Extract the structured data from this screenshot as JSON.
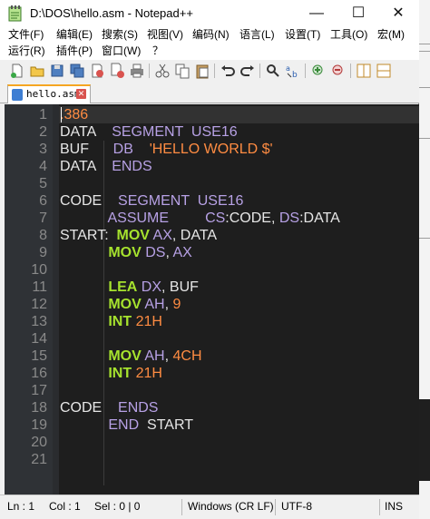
{
  "window": {
    "title": "D:\\DOS\\hello.asm - Notepad++",
    "minimize_glyph": "—",
    "maximize_glyph": "☐",
    "close_glyph": "✕"
  },
  "menu": {
    "row1": [
      "文件(F)",
      "编辑(E)",
      "搜索(S)",
      "视图(V)",
      "编码(N)",
      "语言(L)",
      "设置(T)",
      "工具(O)",
      "宏(M)"
    ],
    "row2": [
      "运行(R)",
      "插件(P)",
      "窗口(W)",
      "？"
    ]
  },
  "toolbar": {
    "icons": [
      "new-file-icon",
      "open-file-icon",
      "save-icon",
      "save-all-icon",
      "close-file-icon",
      "close-all-icon",
      "print-icon",
      "cut-icon",
      "copy-icon",
      "paste-icon",
      "undo-icon",
      "redo-icon",
      "find-icon",
      "replace-icon",
      "zoom-in-icon",
      "zoom-out-icon",
      "sync-scroll-vertical-icon",
      "sync-scroll-horizontal-icon"
    ]
  },
  "tab": {
    "label": "hello.asm",
    "close_glyph": "✕"
  },
  "editor": {
    "line_numbers": [
      "1",
      "2",
      "3",
      "4",
      "5",
      "6",
      "7",
      "8",
      "9",
      "10",
      "11",
      "12",
      "13",
      "14",
      "15",
      "16",
      "17",
      "18",
      "19",
      "20",
      "21"
    ],
    "lines": [
      {
        "n": 1,
        "tokens": [
          {
            "t": ".386",
            "c": "num"
          }
        ]
      },
      {
        "n": 2,
        "tokens": [
          {
            "t": "DATA    ",
            "c": "plain"
          },
          {
            "t": "SEGMENT",
            "c": "kw-seg"
          },
          {
            "t": "  ",
            "c": "plain"
          },
          {
            "t": "USE16",
            "c": "kw-seg"
          }
        ]
      },
      {
        "n": 3,
        "tokens": [
          {
            "t": "BUF      ",
            "c": "plain"
          },
          {
            "t": "DB",
            "c": "kw-seg"
          },
          {
            "t": "    ",
            "c": "plain"
          },
          {
            "t": "'HELLO WORLD $'",
            "c": "str"
          }
        ]
      },
      {
        "n": 4,
        "tokens": [
          {
            "t": "DATA    ",
            "c": "plain"
          },
          {
            "t": "ENDS",
            "c": "kw-seg"
          }
        ]
      },
      {
        "n": 5,
        "tokens": []
      },
      {
        "n": 6,
        "tokens": [
          {
            "t": "CODE    ",
            "c": "plain"
          },
          {
            "t": "SEGMENT",
            "c": "kw-seg"
          },
          {
            "t": "  ",
            "c": "plain"
          },
          {
            "t": "USE16",
            "c": "kw-seg"
          }
        ]
      },
      {
        "n": 7,
        "tokens": [
          {
            "t": "            ",
            "c": "plain"
          },
          {
            "t": "ASSUME",
            "c": "kw-seg"
          },
          {
            "t": "         ",
            "c": "plain"
          },
          {
            "t": "CS",
            "c": "kw-reg"
          },
          {
            "t": ":CODE, ",
            "c": "plain"
          },
          {
            "t": "DS",
            "c": "kw-reg"
          },
          {
            "t": ":DATA",
            "c": "plain"
          }
        ]
      },
      {
        "n": 8,
        "tokens": [
          {
            "t": "START:  ",
            "c": "plain"
          },
          {
            "t": "MOV",
            "c": "kw-ins"
          },
          {
            "t": " ",
            "c": "plain"
          },
          {
            "t": "AX",
            "c": "kw-reg"
          },
          {
            "t": ", DATA",
            "c": "plain"
          }
        ]
      },
      {
        "n": 9,
        "tokens": [
          {
            "t": "            ",
            "c": "plain"
          },
          {
            "t": "MOV",
            "c": "kw-ins"
          },
          {
            "t": " ",
            "c": "plain"
          },
          {
            "t": "DS",
            "c": "kw-reg"
          },
          {
            "t": ", ",
            "c": "plain"
          },
          {
            "t": "AX",
            "c": "kw-reg"
          }
        ]
      },
      {
        "n": 10,
        "tokens": []
      },
      {
        "n": 11,
        "tokens": [
          {
            "t": "            ",
            "c": "plain"
          },
          {
            "t": "LEA",
            "c": "kw-ins"
          },
          {
            "t": " ",
            "c": "plain"
          },
          {
            "t": "DX",
            "c": "kw-reg"
          },
          {
            "t": ", BUF",
            "c": "plain"
          }
        ]
      },
      {
        "n": 12,
        "tokens": [
          {
            "t": "            ",
            "c": "plain"
          },
          {
            "t": "MOV",
            "c": "kw-ins"
          },
          {
            "t": " ",
            "c": "plain"
          },
          {
            "t": "AH",
            "c": "kw-reg"
          },
          {
            "t": ", ",
            "c": "plain"
          },
          {
            "t": "9",
            "c": "num"
          }
        ]
      },
      {
        "n": 13,
        "tokens": [
          {
            "t": "            ",
            "c": "plain"
          },
          {
            "t": "INT",
            "c": "kw-ins"
          },
          {
            "t": " ",
            "c": "plain"
          },
          {
            "t": "21H",
            "c": "num"
          }
        ]
      },
      {
        "n": 14,
        "tokens": []
      },
      {
        "n": 15,
        "tokens": [
          {
            "t": "            ",
            "c": "plain"
          },
          {
            "t": "MOV",
            "c": "kw-ins"
          },
          {
            "t": " ",
            "c": "plain"
          },
          {
            "t": "AH",
            "c": "kw-reg"
          },
          {
            "t": ", ",
            "c": "plain"
          },
          {
            "t": "4CH",
            "c": "num"
          }
        ]
      },
      {
        "n": 16,
        "tokens": [
          {
            "t": "            ",
            "c": "plain"
          },
          {
            "t": "INT",
            "c": "kw-ins"
          },
          {
            "t": " ",
            "c": "plain"
          },
          {
            "t": "21H",
            "c": "num"
          }
        ]
      },
      {
        "n": 17,
        "tokens": []
      },
      {
        "n": 18,
        "tokens": [
          {
            "t": "CODE    ",
            "c": "plain"
          },
          {
            "t": "ENDS",
            "c": "kw-seg"
          }
        ]
      },
      {
        "n": 19,
        "tokens": [
          {
            "t": "            ",
            "c": "plain"
          },
          {
            "t": "END",
            "c": "kw-seg"
          },
          {
            "t": "  START",
            "c": "plain"
          }
        ]
      },
      {
        "n": 20,
        "tokens": []
      },
      {
        "n": 21,
        "tokens": []
      }
    ]
  },
  "status": {
    "ln": "Ln : 1",
    "col": "Col : 1",
    "sel": "Sel : 0 | 0",
    "eol": "Windows (CR LF)",
    "encoding": "UTF-8",
    "mode": "INS"
  },
  "colors": {
    "keyword_segment": "#b7a1e5",
    "keyword_instruction": "#a6e22e",
    "string": "#ff8c42",
    "editor_bg": "#1e1e1e",
    "tab_accent": "#f5a623"
  }
}
